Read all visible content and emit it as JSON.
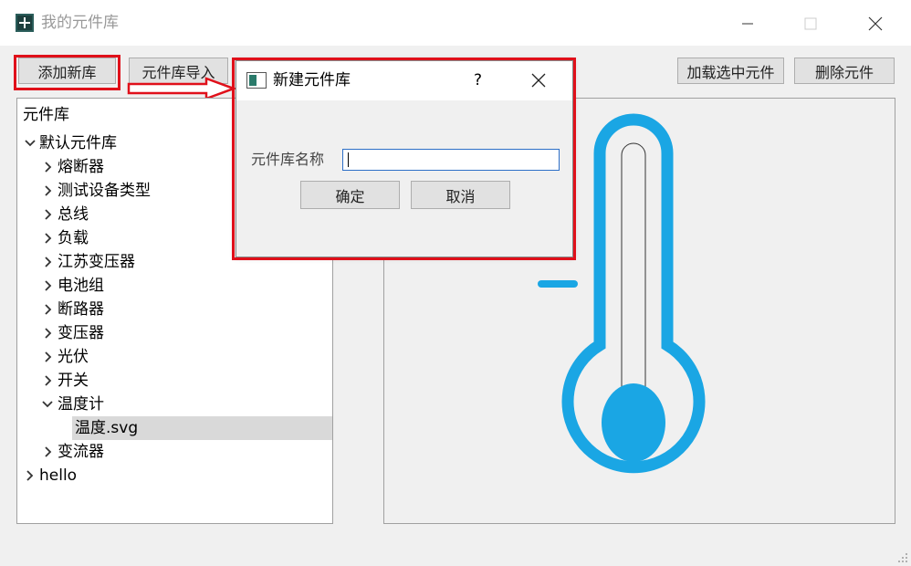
{
  "window": {
    "title": "我的元件库"
  },
  "toolbar": {
    "add_new_label": "添加新库",
    "import_label": "元件库导入",
    "load_selected_label": "加载选中元件",
    "delete_label": "删除元件"
  },
  "tree": {
    "header": "元件库",
    "root": "默认元件库",
    "children": [
      "熔断器",
      "测试设备类型",
      "总线",
      "负载",
      "江苏变压器",
      "电池组",
      "断路器",
      "变压器",
      "光伏",
      "开关",
      "温度计"
    ],
    "selected_leaf": "温度.svg",
    "after": "变流器",
    "other_root": "hello"
  },
  "dialog": {
    "title": "新建元件库",
    "help": "?",
    "field_label": "元件库名称",
    "field_value": "",
    "ok_label": "确定",
    "cancel_label": "取消"
  },
  "colors": {
    "accent_red": "#e0101a",
    "thermo_blue": "#1aa6e4",
    "selection": "#d9d9d9"
  },
  "icons": [
    "app-icon",
    "minimize-icon",
    "maximize-icon",
    "close-icon",
    "chevron-right-icon",
    "chevron-down-icon",
    "arrow-icon",
    "thermometer-icon",
    "resize-grip-icon"
  ]
}
